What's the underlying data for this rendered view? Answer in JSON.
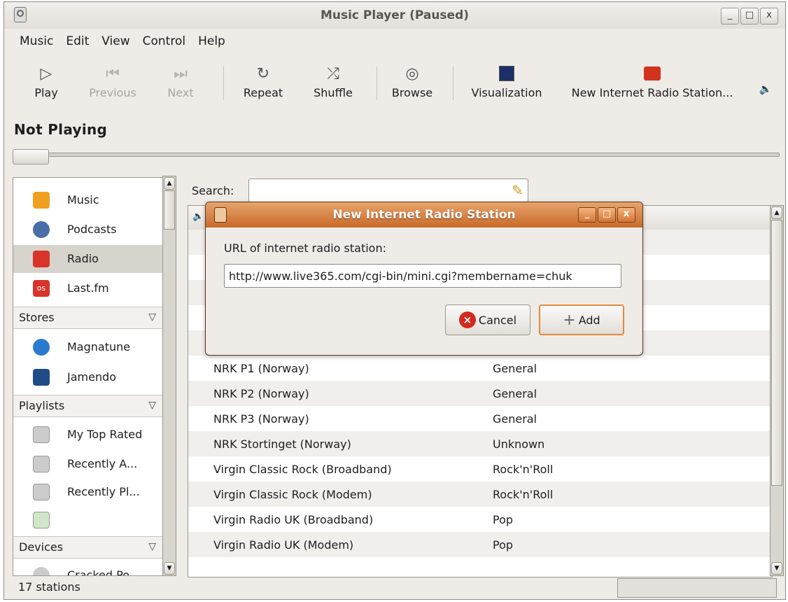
{
  "window": {
    "title": "Music Player (Paused)",
    "controls": [
      "_",
      "□",
      "x"
    ]
  },
  "menu": [
    "Music",
    "Edit",
    "View",
    "Control",
    "Help"
  ],
  "toolbar": {
    "play": "Play",
    "previous": "Previous",
    "next": "Next",
    "repeat": "Repeat",
    "shuffle": "Shuffle",
    "browse": "Browse",
    "visualization": "Visualization",
    "new_radio": "New Internet Radio Station..."
  },
  "now_playing": "Not Playing",
  "sidebar": {
    "library": [
      "Music",
      "Podcasts",
      "Radio",
      "Last.fm"
    ],
    "stores_header": "Stores",
    "stores": [
      "Magnatune",
      "Jamendo"
    ],
    "playlists_header": "Playlists",
    "playlists": [
      "My Top Rated",
      "Recently A...",
      "Recently Pl...",
      ""
    ],
    "devices_header": "Devices",
    "devices": [
      "Cracked Po"
    ]
  },
  "search": {
    "label": "Search:",
    "value": ""
  },
  "stations": [
    {
      "name": "NRK P1 (Norway)",
      "genre": "General"
    },
    {
      "name": "NRK P2 (Norway)",
      "genre": "General"
    },
    {
      "name": "NRK P3 (Norway)",
      "genre": "General"
    },
    {
      "name": "NRK Stortinget (Norway)",
      "genre": "Unknown"
    },
    {
      "name": "Virgin Classic Rock (Broadband)",
      "genre": "Rock'n'Roll"
    },
    {
      "name": "Virgin Classic Rock (Modem)",
      "genre": "Rock'n'Roll"
    },
    {
      "name": "Virgin Radio UK (Broadband)",
      "genre": "Pop"
    },
    {
      "name": "Virgin Radio UK (Modem)",
      "genre": "Pop"
    }
  ],
  "status": "17 stations",
  "dialog": {
    "title": "New Internet Radio Station",
    "url_label": "URL of internet radio station:",
    "url_value": "http://www.live365.com/cgi-bin/mini.cgi?membername=chuk",
    "cancel": "Cancel",
    "add": "Add"
  }
}
